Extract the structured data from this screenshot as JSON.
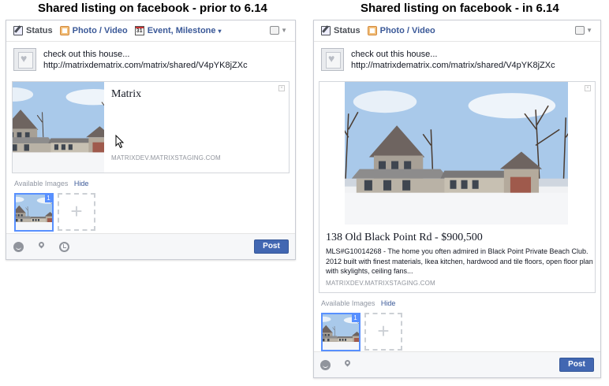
{
  "headings": {
    "left": "Shared listing on facebook - prior to 6.14",
    "right": "Shared listing on facebook - in 6.14"
  },
  "left_panel": {
    "tabs": [
      {
        "label": "Status",
        "icon": "pencil-icon"
      },
      {
        "label": "Photo / Video",
        "icon": "photo-icon"
      },
      {
        "label": "Event, Milestone",
        "icon": "calendar-icon",
        "caret": "▾"
      }
    ],
    "calendar_day": "31",
    "post_text_line1": "check out this house...",
    "post_text_line2": "http://matrixdematrix.com/matrix/shared/V4pYK8jZXc",
    "card_title": "Matrix",
    "card_domain": "MATRIXDEV.MATRIXSTAGING.COM",
    "available_images": "Available Images",
    "hide": "Hide",
    "thumb_number": "1",
    "add_glyph": "+",
    "post_button": "Post"
  },
  "right_panel": {
    "tabs": [
      {
        "label": "Status",
        "icon": "pencil-icon"
      },
      {
        "label": "Photo / Video",
        "icon": "photo-icon"
      }
    ],
    "post_text_line1": "check out this house...",
    "post_text_line2": "http://matrixdematrix.com/matrix/shared/V4pYK8jZXc",
    "card_title": "138 Old Black Point Rd - $900,500",
    "card_description": "MLS#G10014268 - The home you often admired in Black Point Private Beach Club. 2012 built with finest materials, Ikea kitchen, hardwood and tile floors, open floor plan with skylights, ceiling fans...",
    "card_domain": "MATRIXDEV.MATRIXSTAGING.COM",
    "available_images": "Available Images",
    "hide": "Hide",
    "thumb_number": "1",
    "add_glyph": "+",
    "post_button": "Post"
  },
  "colors": {
    "facebook_blue": "#3b5998",
    "post_button": "#4267b2",
    "thumb_border": "#5890ff"
  }
}
